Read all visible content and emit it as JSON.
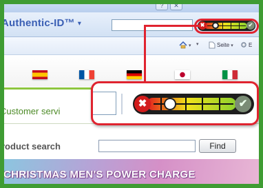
{
  "browser": {
    "toolbar_brand": "Authentic-ID™",
    "brand_dropdown_glyph": "▾",
    "window_buttons": [
      "?",
      "✕"
    ],
    "nav_items": [
      {
        "icon": "home-icon",
        "label": ""
      },
      {
        "icon": "print-icon",
        "label": ""
      },
      {
        "icon": "page-icon",
        "label": "Seite"
      },
      {
        "icon": "tools-icon",
        "label": "E"
      }
    ]
  },
  "id_meter": {
    "level": 0.25,
    "fail_glyph": "✖",
    "ok_glyph": "✔"
  },
  "page": {
    "flags": [
      "es-flag",
      "fr-flag",
      "de-flag",
      "jp-flag",
      "it-flag"
    ],
    "customer_service": "Customer servi",
    "product_search_label": "roduct search",
    "find_button": "Find",
    "banner_text": "CHRISTMAS MEN'S POWER CHARGE"
  },
  "colors": {
    "frame": "#3f9c33",
    "callout": "#e0232f",
    "brand": "#3a5fb4",
    "service_text": "#4c8a26"
  }
}
